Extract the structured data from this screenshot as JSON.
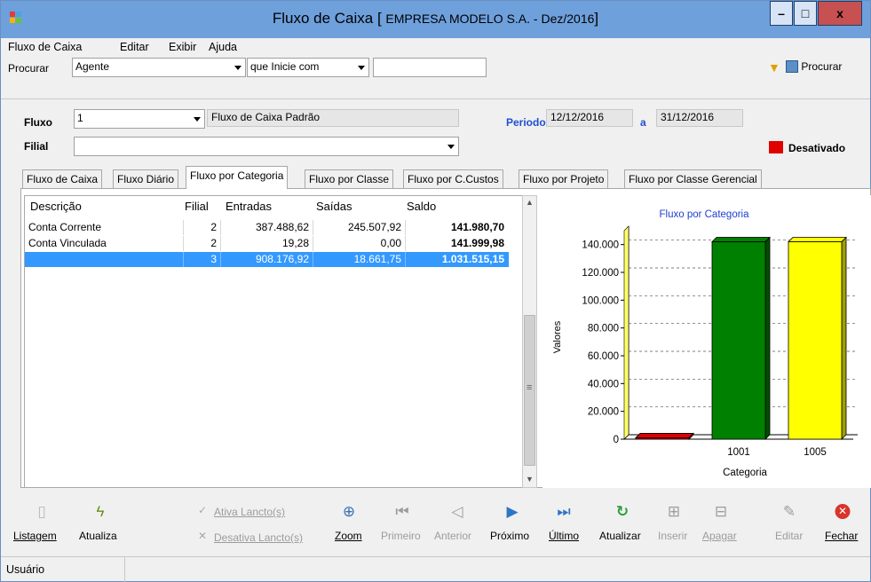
{
  "window": {
    "title_prefix": "Fluxo de Caixa [ ",
    "title_company": "EMPRESA MODELO S.A. - Dez/2016",
    "title_suffix": "]",
    "minimize": "–",
    "maximize": "□",
    "close": "x"
  },
  "menu": [
    "Fluxo de Caixa",
    "Editar",
    "Exibir",
    "Ajuda"
  ],
  "search": {
    "label": "Procurar",
    "field": "Agente",
    "mode": "que Inicie com",
    "value": "",
    "button": "Procurar"
  },
  "filter": {
    "fluxo_label": "Fluxo",
    "fluxo_value": "1",
    "fluxo_name": "Fluxo de Caixa Padrão",
    "periodo_label": "Periodo",
    "periodo_start": "12/12/2016",
    "periodo_sep": "a",
    "periodo_end": "31/12/2016",
    "filial_label": "Filial",
    "filial_value": "",
    "status": "Desativado"
  },
  "tabs": [
    "Fluxo de Caixa",
    "Fluxo Diário",
    "Fluxo por Categoria",
    "Fluxo por Classe",
    "Fluxo por C.Custos",
    "Fluxo por Projeto",
    "Fluxo por Classe Gerencial"
  ],
  "grid": {
    "headers": [
      "Descrição",
      "Filial",
      "Entradas",
      "Saídas",
      "Saldo"
    ],
    "rows": [
      {
        "descricao": "Conta Corrente",
        "filial": "2",
        "entradas": "387.488,62",
        "saidas": "245.507,92",
        "saldo": "141.980,70"
      },
      {
        "descricao": "Conta Vinculada",
        "filial": "2",
        "entradas": "19,28",
        "saidas": "0,00",
        "saldo": "141.999,98"
      },
      {
        "descricao": "",
        "filial": "3",
        "entradas": "908.176,92",
        "saidas": "18.661,75",
        "saldo": "1.031.515,15"
      }
    ],
    "scroll_grip": "≡"
  },
  "chart_data": {
    "type": "bar",
    "title": "Fluxo por Categoria",
    "xlabel": "Categoria",
    "ylabel": "Valores",
    "categories": [
      "",
      "1001",
      "1005"
    ],
    "values": [
      1000,
      141980.7,
      141999.98
    ],
    "colors": [
      "#dd0000",
      "#008000",
      "#ffff00"
    ],
    "ylim": [
      0,
      150000
    ],
    "yticks": [
      "0",
      "20.000",
      "40.000",
      "60.000",
      "80.000",
      "100.000",
      "120.000",
      "140.000"
    ],
    "grid": true,
    "style": "3d"
  },
  "toolbar": {
    "listagem": "Listagem",
    "atualiza": "Atualiza",
    "ativa": "Ativa Lancto(s)",
    "desativa": "Desativa Lancto(s)",
    "zoom": "Zoom",
    "primeiro": "Primeiro",
    "anterior": "Anterior",
    "proximo": "Próximo",
    "ultimo": "Último",
    "atualizar": "Atualizar",
    "inserir": "Inserir",
    "apagar": "Apagar",
    "editar": "Editar",
    "fechar": "Fechar"
  },
  "status": {
    "usuario": "Usuário"
  }
}
